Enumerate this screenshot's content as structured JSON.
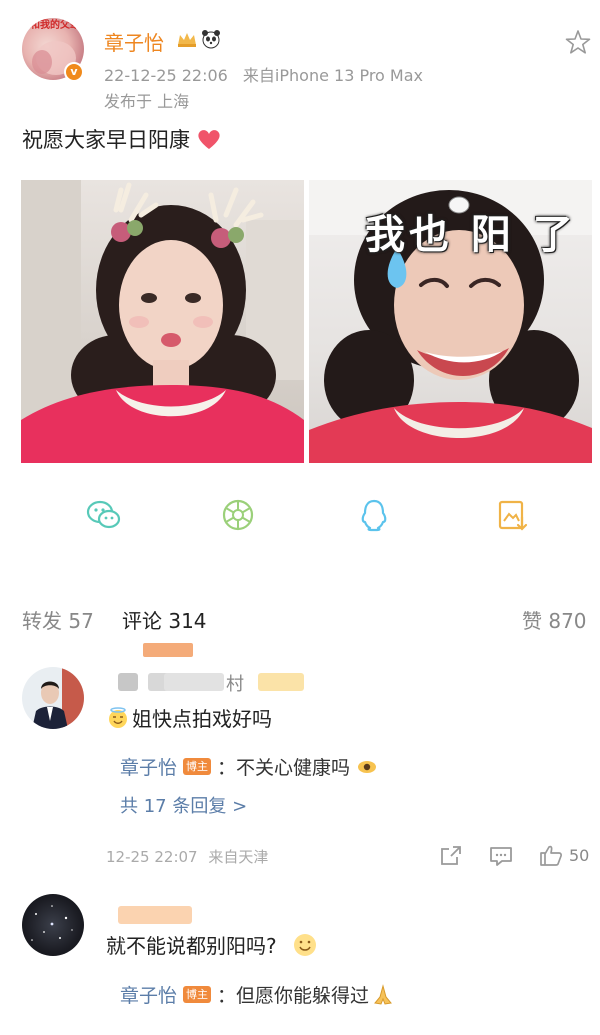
{
  "post": {
    "username": "章子怡",
    "time": "22-12-25 22:06",
    "device": "来自iPhone 13 Pro Max",
    "location": "发布于 上海",
    "text": "祝愿大家早日阳康",
    "avatar_overlay_text": "我和我的父辈",
    "badge": "v",
    "image_right_text": "我也 阳 了"
  },
  "stats": {
    "repost_label": "转发",
    "repost_count": "57",
    "comment_label": "评论",
    "comment_count": "314",
    "like_label": "赞",
    "like_count": "870"
  },
  "comments": [
    {
      "text": "姐快点拍戏好吗",
      "reply_name": "章子怡",
      "reply_tag": "博主",
      "reply_text": "：不关心健康吗",
      "more_replies": "共 17 条回复 >",
      "time": "12-25 22:07",
      "from": "来自天津",
      "likes": "50",
      "name_tail": "村"
    },
    {
      "text": "就不能说都别阳吗?",
      "reply_name": "章子怡",
      "reply_tag": "博主",
      "reply_text": "：但愿你能躲得过"
    }
  ],
  "colors": {
    "username": "#ee8620",
    "reply_name": "#5b7da8",
    "tag": "#f08a3c"
  }
}
